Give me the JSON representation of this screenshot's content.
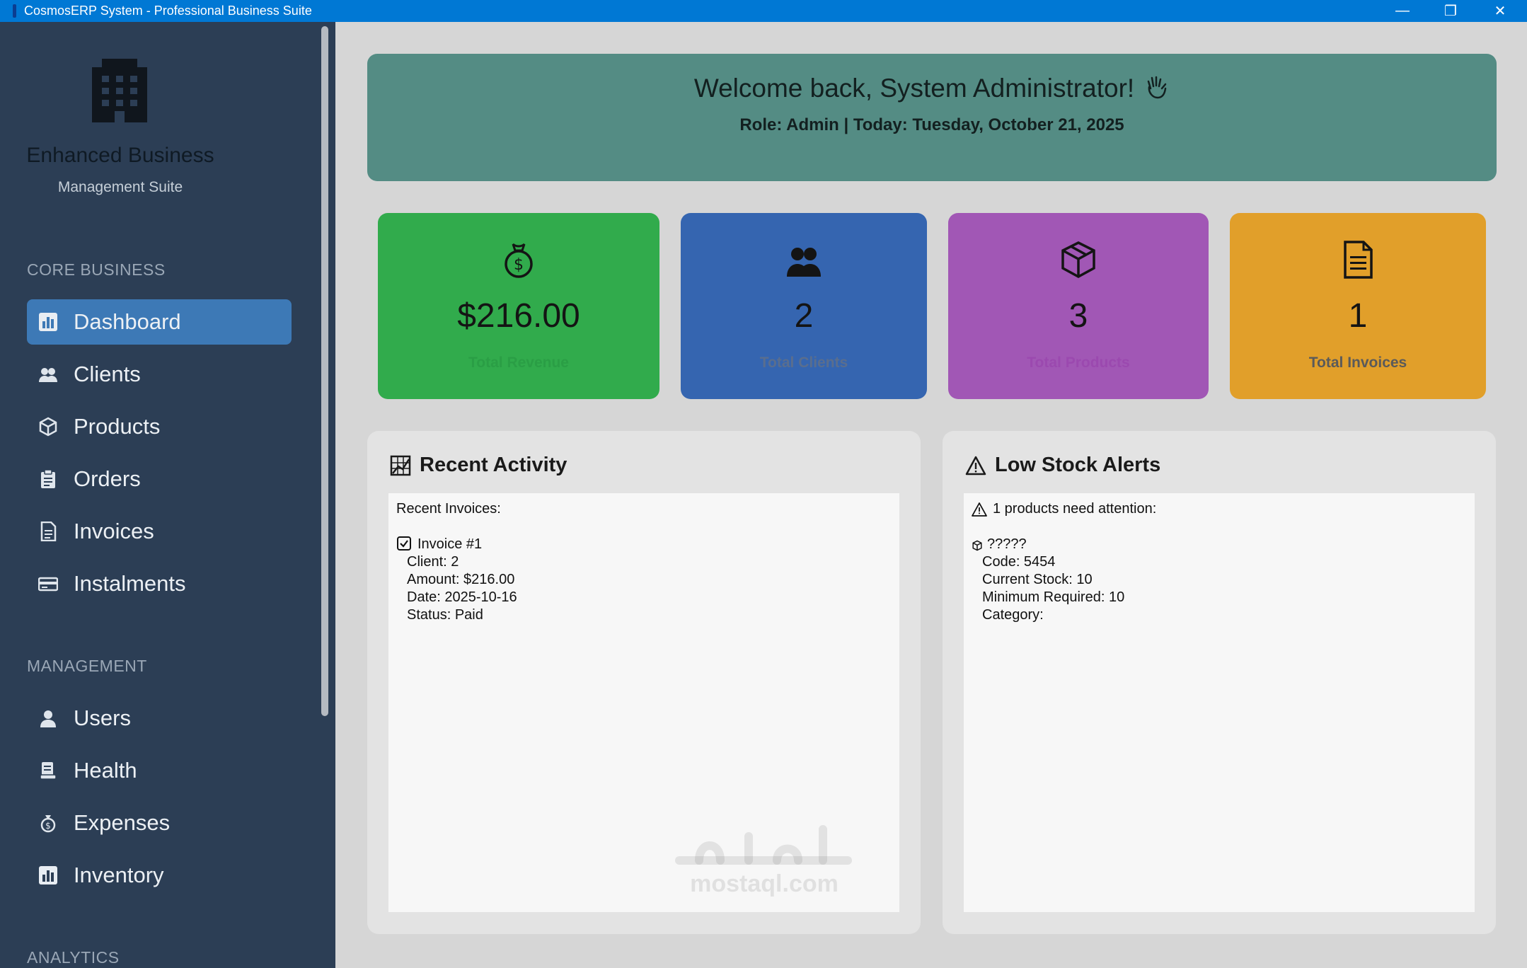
{
  "window": {
    "title": "CosmosERP System - Professional Business Suite",
    "controls": {
      "minimize": "—",
      "maximize": "❐",
      "close": "✕"
    }
  },
  "sidebar": {
    "brand_title": "Enhanced Business",
    "brand_subtitle": "Management Suite",
    "sections": [
      {
        "title": "CORE BUSINESS",
        "items": [
          {
            "label": "Dashboard",
            "icon": "bar-chart-icon",
            "active": true
          },
          {
            "label": "Clients",
            "icon": "users-icon"
          },
          {
            "label": "Products",
            "icon": "package-icon"
          },
          {
            "label": "Orders",
            "icon": "clipboard-icon"
          },
          {
            "label": "Invoices",
            "icon": "document-icon"
          },
          {
            "label": "Instalments",
            "icon": "credit-card-icon"
          }
        ]
      },
      {
        "title": "MANAGEMENT",
        "items": [
          {
            "label": "Users",
            "icon": "user-icon"
          },
          {
            "label": "Health",
            "icon": "receipt-icon"
          },
          {
            "label": "Expenses",
            "icon": "money-bag-icon"
          },
          {
            "label": "Inventory",
            "icon": "bar-chart-icon"
          }
        ]
      },
      {
        "title": "ANALYTICS",
        "items": []
      }
    ]
  },
  "welcome": {
    "title": "Welcome back, System Administrator!",
    "icon": "waving-hand-icon",
    "subtitle": "Role: Admin | Today: Tuesday, October 21, 2025",
    "color": "#548c84"
  },
  "stats": [
    {
      "value": "$216.00",
      "label": "Total Revenue",
      "icon": "money-bag-icon",
      "color": "#31ab4c",
      "label_color": "#2a9e45"
    },
    {
      "value": "2",
      "label": "Total Clients",
      "icon": "users-icon",
      "color": "#3565b0",
      "label_color": "#5a6e8e"
    },
    {
      "value": "3",
      "label": "Total Products",
      "icon": "package-icon",
      "color": "#a157b5",
      "label_color": "#9b49af"
    },
    {
      "value": "1",
      "label": "Total Invoices",
      "icon": "document-icon",
      "color": "#e19f2a",
      "label_color": "#5a5a5a"
    }
  ],
  "recent_activity": {
    "title": "Recent Activity",
    "heading": "Recent Invoices:",
    "entry_title": "Invoice #1",
    "lines": [
      "Client: 2",
      "Amount: $216.00",
      "Date: 2025-10-16",
      "Status: Paid"
    ]
  },
  "low_stock": {
    "title": "Low Stock Alerts",
    "heading": "1 products need attention:",
    "entry_title": "?????",
    "lines": [
      "Code: 5454",
      "Current Stock: 10",
      "Minimum Required: 10",
      "Category:"
    ]
  },
  "watermark": {
    "text": "mostaql.com"
  }
}
